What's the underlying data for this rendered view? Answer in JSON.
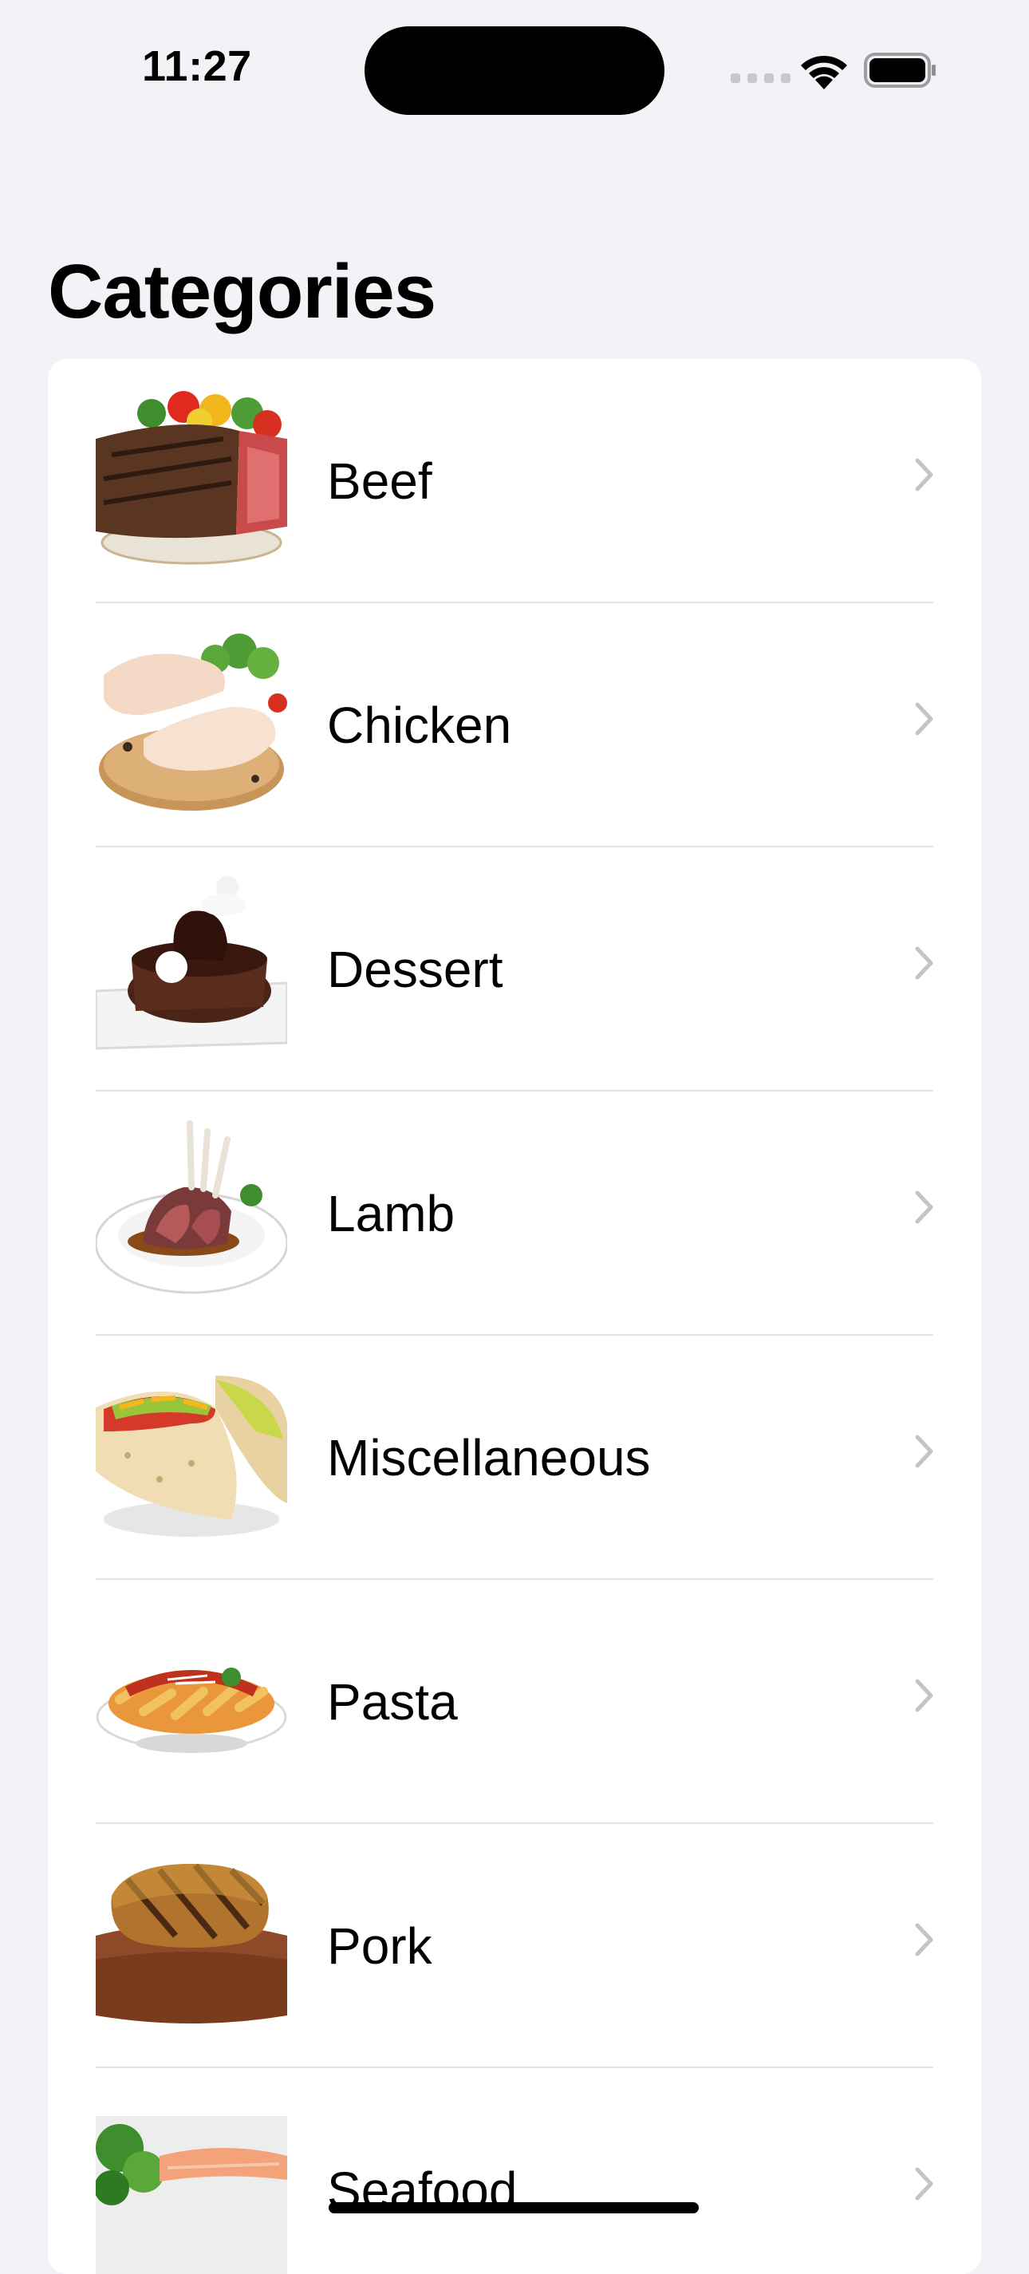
{
  "status_bar": {
    "time": "11:27",
    "icons": [
      "cellular-signal-icon",
      "wifi-icon",
      "battery-icon"
    ]
  },
  "screen": {
    "title": "Categories"
  },
  "categories": [
    {
      "label": "Beef",
      "image": "beef-steak-image"
    },
    {
      "label": "Chicken",
      "image": "raw-chicken-image"
    },
    {
      "label": "Dessert",
      "image": "chocolate-cake-image"
    },
    {
      "label": "Lamb",
      "image": "lamb-chops-image"
    },
    {
      "label": "Miscellaneous",
      "image": "tacos-image"
    },
    {
      "label": "Pasta",
      "image": "penne-pasta-image"
    },
    {
      "label": "Pork",
      "image": "grilled-pork-image"
    },
    {
      "label": "Seafood",
      "image": "salmon-plate-image"
    }
  ],
  "colors": {
    "background": "#F2F2F7",
    "card": "#FFFFFF",
    "chevron": "#C4C4C7",
    "separator": "#E3E3E8"
  }
}
